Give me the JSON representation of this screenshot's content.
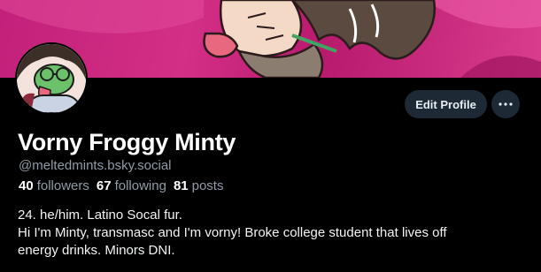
{
  "profile": {
    "display_name": "Vorny Froggy Minty",
    "handle": "@meltedmints.bsky.social",
    "bio_lines": [
      "24. he/him. Latino Socal fur.",
      "Hi I'm Minty, transmasc and I'm vorny! Broke college student that lives off",
      "energy drinks. Minors DNI."
    ]
  },
  "stats": {
    "followers": {
      "count": "40",
      "label": "followers"
    },
    "following": {
      "count": "67",
      "label": "following"
    },
    "posts": {
      "count": "81",
      "label": "posts"
    }
  },
  "actions": {
    "edit_profile_label": "Edit Profile",
    "more_icon": "ellipsis-icon"
  },
  "colors": {
    "background": "#000000",
    "banner": "#c2207a",
    "button_bg": "#1e2936",
    "muted_text": "#8f9ba8"
  }
}
